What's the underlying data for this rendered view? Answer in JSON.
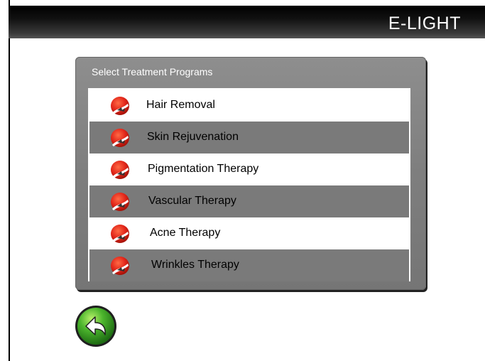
{
  "header": {
    "brand": "E-LIGHT"
  },
  "panel": {
    "title": "Select Treatment Programs",
    "items": [
      {
        "label": "Hair Removal",
        "icon": "treatment-icon"
      },
      {
        "label": "Skin Rejuvenation",
        "icon": "treatment-icon"
      },
      {
        "label": "Pigmentation Therapy",
        "icon": "treatment-icon"
      },
      {
        "label": "Vascular Therapy",
        "icon": "treatment-icon"
      },
      {
        "label": "Acne Therapy",
        "icon": "treatment-icon"
      },
      {
        "label": "Wrinkles Therapy",
        "icon": "treatment-icon"
      }
    ]
  },
  "footer": {
    "back_icon": "back-arrow-icon"
  },
  "colors": {
    "header_bg": "#000000",
    "panel_bg": "#808080",
    "row_alt": "#7a7a7a",
    "icon_red": "#e2261a",
    "back_green": "#3da32a"
  }
}
